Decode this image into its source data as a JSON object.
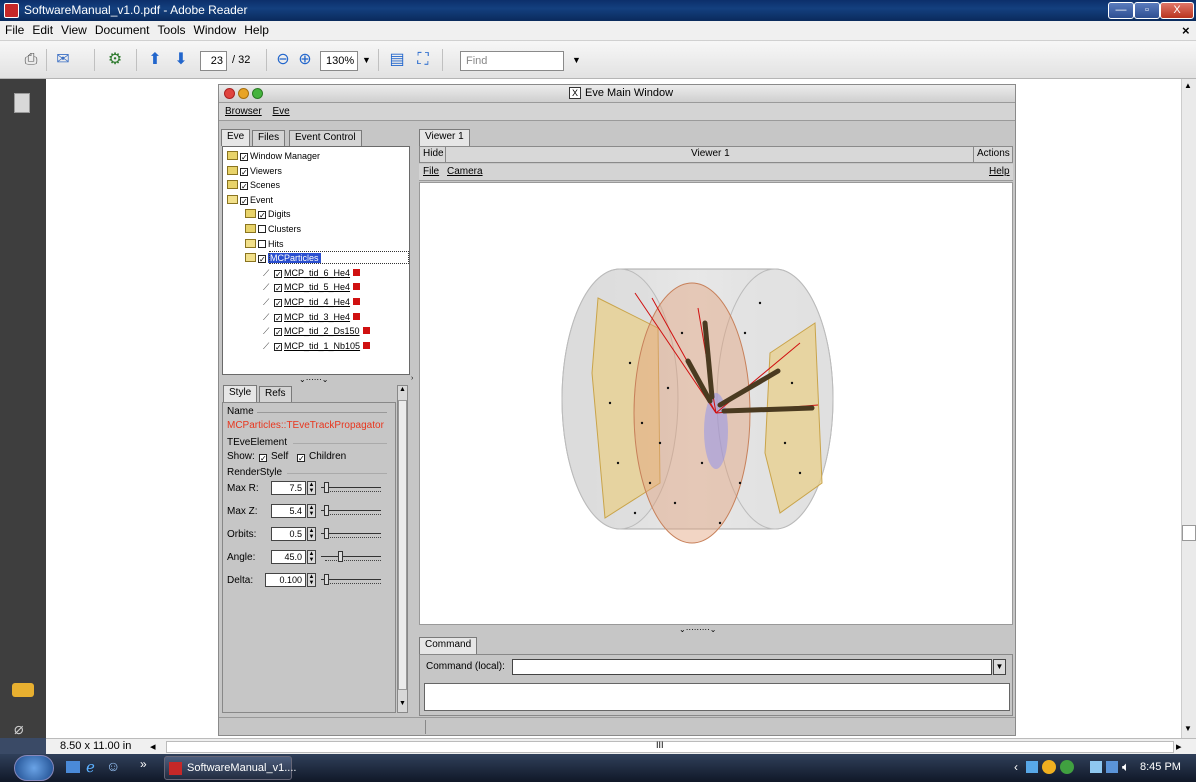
{
  "window": {
    "title": "SoftwareManual_v1.0.pdf - Adobe Reader",
    "minimize": "—",
    "maximize": "▫",
    "close": "X"
  },
  "menu": [
    "File",
    "Edit",
    "View",
    "Document",
    "Tools",
    "Window",
    "Help"
  ],
  "menu_close": "×",
  "toolbar": {
    "page_current": "23",
    "page_total": "/ 32",
    "zoom": "130%",
    "find_placeholder": "Find"
  },
  "status": {
    "page_size": "8.50 x 11.00 in",
    "scroll_center": "III"
  },
  "taskbar": {
    "task_label": "SoftwareManual_v1....",
    "time": "8:45 PM",
    "quick_more": "»"
  },
  "eve": {
    "title": "Eve Main Window",
    "title_icon": "X",
    "menus": [
      "Browser",
      "Eve"
    ],
    "left_tabs": [
      "Eve",
      "Files",
      "Event Control"
    ],
    "tree": [
      {
        "label": "Window Manager",
        "indent": 0,
        "type": "folder",
        "checked": true
      },
      {
        "label": "Viewers",
        "indent": 0,
        "type": "folder",
        "checked": true
      },
      {
        "label": "Scenes",
        "indent": 0,
        "type": "folder",
        "checked": true
      },
      {
        "label": "Event",
        "indent": 0,
        "type": "folder-open",
        "checked": true
      },
      {
        "label": "Digits",
        "indent": 1,
        "type": "folder",
        "checked": true
      },
      {
        "label": "Clusters",
        "indent": 1,
        "type": "folder",
        "checked": false
      },
      {
        "label": "Hits",
        "indent": 1,
        "type": "folder-open",
        "checked": false
      },
      {
        "label": "MCParticles",
        "indent": 1,
        "type": "folder-open",
        "checked": true,
        "selected": true
      },
      {
        "label": "MCP_tid_6_He4",
        "indent": 2,
        "type": "track",
        "checked": true
      },
      {
        "label": "MCP_tid_5_He4",
        "indent": 2,
        "type": "track",
        "checked": true
      },
      {
        "label": "MCP_tid_4_He4",
        "indent": 2,
        "type": "track",
        "checked": true
      },
      {
        "label": "MCP_tid_3_He4",
        "indent": 2,
        "type": "track",
        "checked": true
      },
      {
        "label": "MCP_tid_2_Ds150",
        "indent": 2,
        "type": "track",
        "checked": true
      },
      {
        "label": "MCP_tid_1_Nb105",
        "indent": 2,
        "type": "track",
        "checked": true
      }
    ],
    "editor_tabs": [
      "Style",
      "Refs"
    ],
    "editor": {
      "name_label": "Name",
      "name_value": "MCParticles::TEveTrackPropagator",
      "element_label": "TEveElement",
      "show_label": "Show:",
      "self_label": "Self",
      "children_label": "Children",
      "renderstyle_label": "RenderStyle",
      "fields": [
        {
          "label": "Max R:",
          "value": "7.5",
          "knob": 0.05
        },
        {
          "label": "Max Z:",
          "value": "5.4",
          "knob": 0.05
        },
        {
          "label": "Orbits:",
          "value": "0.5",
          "knob": 0.05
        },
        {
          "label": "Angle:",
          "value": "45.0",
          "knob": 0.3
        },
        {
          "label": "Delta:",
          "value": "0.100",
          "knob": 0.05
        }
      ],
      "check_mark": "✓"
    },
    "viewer_tab": "Viewer 1",
    "viewer_bar": {
      "hide": "Hide",
      "title": "Viewer 1",
      "actions": "Actions"
    },
    "viewer_menu": {
      "file": "File",
      "camera": "Camera",
      "help": "Help"
    },
    "command_tab": "Command",
    "command_label": "Command (local):",
    "command_value": "",
    "dropdown_arrow": "▼"
  },
  "colors": {
    "accent_red": "#e8361e",
    "selected_blue": "#2a4fd0",
    "track_red": "#d01010"
  }
}
